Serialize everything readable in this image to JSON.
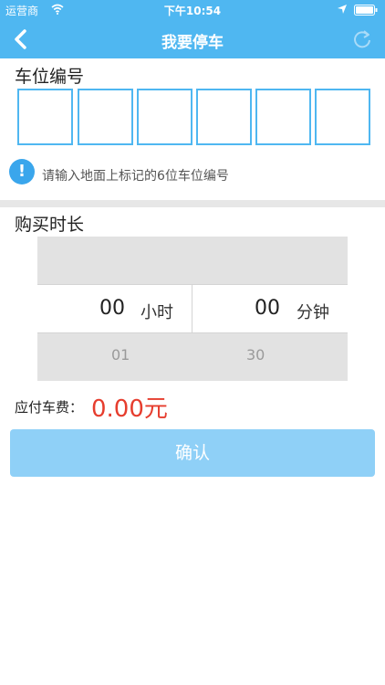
{
  "status_bar": {
    "carrier": "运营商",
    "time": "下午10:54"
  },
  "nav": {
    "title": "我要停车",
    "back_icon": "chevron-left-icon",
    "refresh_icon": "refresh-icon"
  },
  "space_code": {
    "title": "车位编号",
    "boxes": [
      "",
      "",
      "",
      "",
      "",
      ""
    ],
    "hint": "请输入地面上标记的6位车位编号",
    "hint_icon": "info-icon"
  },
  "duration": {
    "title": "购买时长",
    "hours_value": "00",
    "hours_unit": "小时",
    "hours_next": "01",
    "minutes_value": "00",
    "minutes_unit": "分钟",
    "minutes_next": "30"
  },
  "fee": {
    "label": "应付车费：",
    "amount": "0.00元"
  },
  "confirm": {
    "label": "确认"
  },
  "colors": {
    "brand_blue": "#4fb7f1",
    "fee_red": "#e63d2e",
    "button_disabled": "#8fd0f7"
  }
}
